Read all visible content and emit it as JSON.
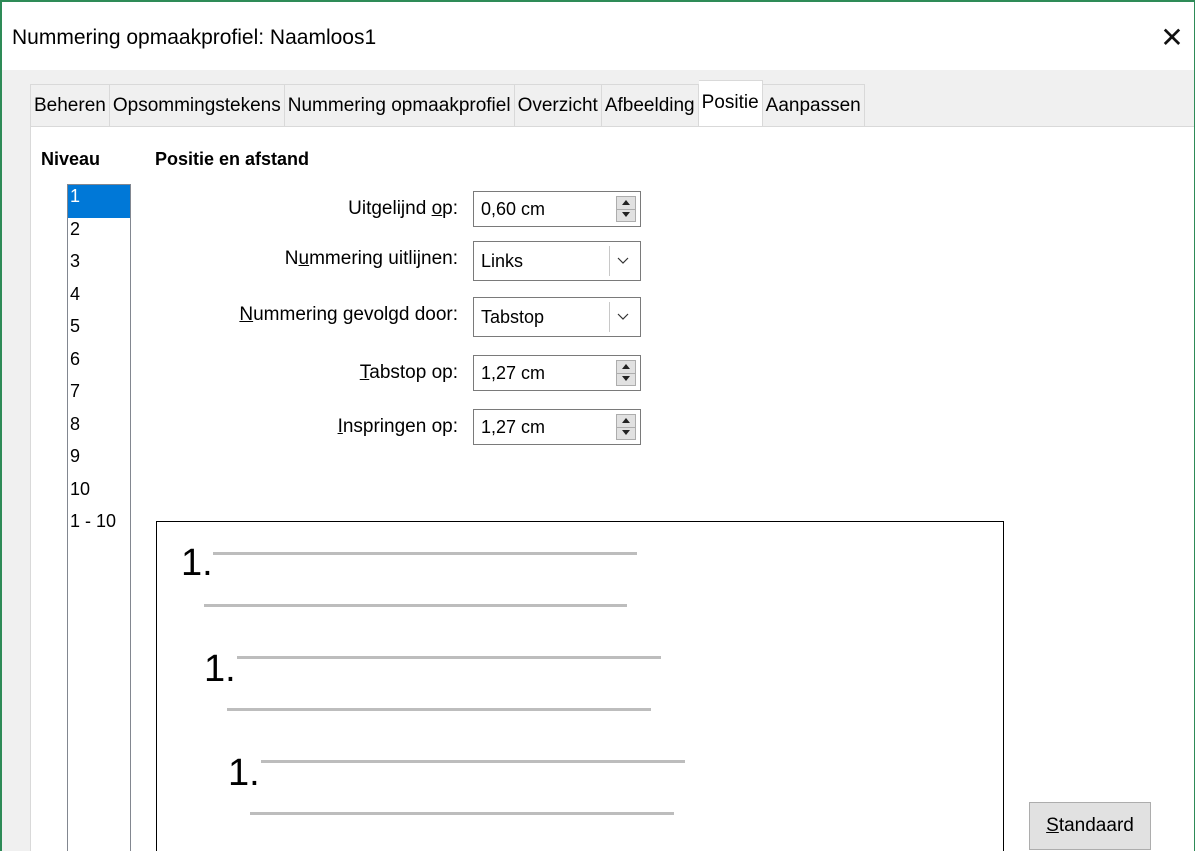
{
  "window": {
    "title": "Nummering opmaakprofiel: Naamloos1",
    "close_glyph": "✕"
  },
  "tabs": [
    {
      "label": "Beheren"
    },
    {
      "label": "Opsommingstekens"
    },
    {
      "label": "Nummering opmaakprofiel"
    },
    {
      "label": "Overzicht"
    },
    {
      "label": "Afbeelding"
    },
    {
      "label": "Positie",
      "active": true
    },
    {
      "label": "Aanpassen"
    }
  ],
  "level": {
    "heading": "Niveau",
    "items": [
      "1",
      "2",
      "3",
      "4",
      "5",
      "6",
      "7",
      "8",
      "9",
      "10",
      "1 - 10"
    ],
    "selected": "1"
  },
  "position": {
    "heading": "Positie en afstand",
    "aligned_at": {
      "label_pre": "Uitgelijnd ",
      "label_ul": "o",
      "label_post": "p:",
      "value": "0,60 cm"
    },
    "numbering_align": {
      "label_pre": "N",
      "label_ul": "u",
      "label_post": "mmering uitlijnen:",
      "value": "Links"
    },
    "followed_by": {
      "label_pre": "",
      "label_ul": "N",
      "label_post": "ummering gevolgd door:",
      "value": "Tabstop"
    },
    "tab_stop": {
      "label_pre": "",
      "label_ul": "T",
      "label_post": "abstop op:",
      "value": "1,27 cm"
    },
    "indent": {
      "label_pre": "",
      "label_ul": "I",
      "label_post": "nspringen op:",
      "value": "1,27 cm"
    }
  },
  "preview": {
    "numbers": [
      "1.",
      "1.",
      "1."
    ]
  },
  "buttons": {
    "default": {
      "label_ul": "S",
      "label_post": "tandaard"
    }
  },
  "colors": {
    "window_border": "#2e8b57",
    "selection": "#0078d7",
    "preview_line": "#bdbdbd"
  }
}
